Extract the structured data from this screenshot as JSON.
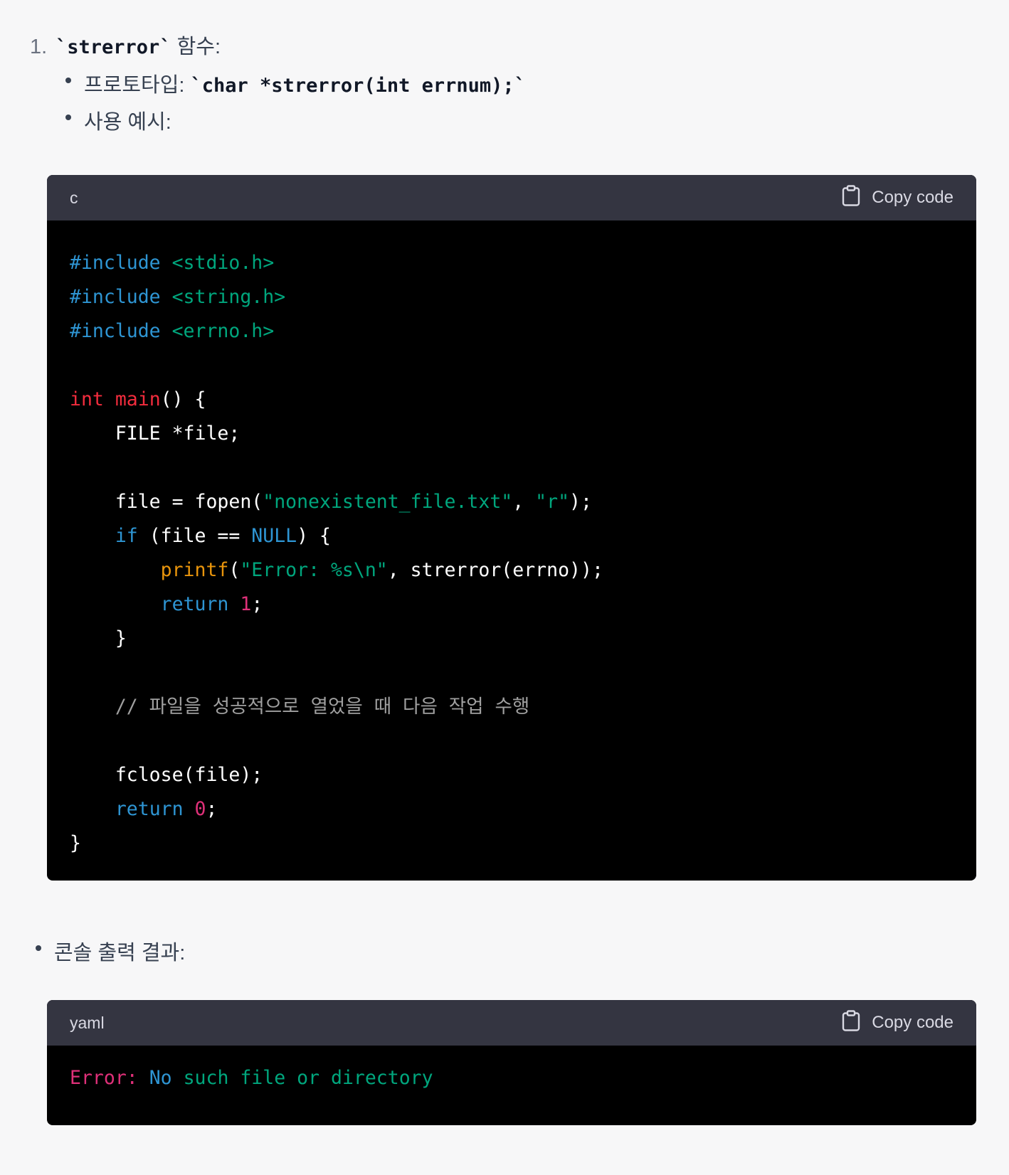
{
  "item1": {
    "number": "1.",
    "code_name": "`strerror`",
    "suffix": " 함수:"
  },
  "bullets": {
    "prototype_label": "프로토타입: ",
    "prototype_code": "`char *strerror(int errnum);`",
    "usage_label": "사용 예시:",
    "console_label": "콘솔 출력 결과:"
  },
  "code_block_c": {
    "language": "c",
    "copy_label": "Copy code",
    "lines": [
      [
        {
          "t": "#include ",
          "c": "tok-pre"
        },
        {
          "t": "<stdio.h>",
          "c": "tok-str"
        }
      ],
      [
        {
          "t": "#include ",
          "c": "tok-pre"
        },
        {
          "t": "<string.h>",
          "c": "tok-str"
        }
      ],
      [
        {
          "t": "#include ",
          "c": "tok-pre"
        },
        {
          "t": "<errno.h>",
          "c": "tok-str"
        }
      ],
      [],
      [
        {
          "t": "int ",
          "c": "tok-type"
        },
        {
          "t": "main",
          "c": "tok-fn"
        },
        {
          "t": "() {",
          "c": "tok-plain"
        }
      ],
      [
        {
          "t": "    FILE *file;",
          "c": "tok-plain"
        }
      ],
      [],
      [
        {
          "t": "    file = fopen(",
          "c": "tok-plain"
        },
        {
          "t": "\"nonexistent_file.txt\"",
          "c": "tok-str"
        },
        {
          "t": ", ",
          "c": "tok-plain"
        },
        {
          "t": "\"r\"",
          "c": "tok-str"
        },
        {
          "t": ");",
          "c": "tok-plain"
        }
      ],
      [
        {
          "t": "    ",
          "c": "tok-plain"
        },
        {
          "t": "if",
          "c": "tok-kw"
        },
        {
          "t": " (file == ",
          "c": "tok-plain"
        },
        {
          "t": "NULL",
          "c": "tok-kw"
        },
        {
          "t": ") {",
          "c": "tok-plain"
        }
      ],
      [
        {
          "t": "        ",
          "c": "tok-plain"
        },
        {
          "t": "printf",
          "c": "tok-builtin"
        },
        {
          "t": "(",
          "c": "tok-plain"
        },
        {
          "t": "\"Error: %s\\n\"",
          "c": "tok-str"
        },
        {
          "t": ", strerror(errno));",
          "c": "tok-plain"
        }
      ],
      [
        {
          "t": "        ",
          "c": "tok-plain"
        },
        {
          "t": "return",
          "c": "tok-kw"
        },
        {
          "t": " ",
          "c": "tok-plain"
        },
        {
          "t": "1",
          "c": "tok-num"
        },
        {
          "t": ";",
          "c": "tok-plain"
        }
      ],
      [
        {
          "t": "    }",
          "c": "tok-plain"
        }
      ],
      [],
      [
        {
          "t": "    // 파일을 성공적으로 열었을 때 다음 작업 수행",
          "c": "tok-comment"
        }
      ],
      [],
      [
        {
          "t": "    fclose(file);",
          "c": "tok-plain"
        }
      ],
      [
        {
          "t": "    ",
          "c": "tok-plain"
        },
        {
          "t": "return",
          "c": "tok-kw"
        },
        {
          "t": " ",
          "c": "tok-plain"
        },
        {
          "t": "0",
          "c": "tok-num"
        },
        {
          "t": ";",
          "c": "tok-plain"
        }
      ],
      [
        {
          "t": "}",
          "c": "tok-plain"
        }
      ]
    ]
  },
  "code_block_yaml": {
    "language": "yaml",
    "copy_label": "Copy code",
    "lines": [
      [
        {
          "t": "Error:",
          "c": "tok-key"
        },
        {
          "t": " ",
          "c": "tok-plain"
        },
        {
          "t": "No",
          "c": "tok-kw2"
        },
        {
          "t": " such file or directory",
          "c": "tok-yv"
        }
      ]
    ]
  },
  "icons": {
    "copy": "clipboard-icon"
  }
}
